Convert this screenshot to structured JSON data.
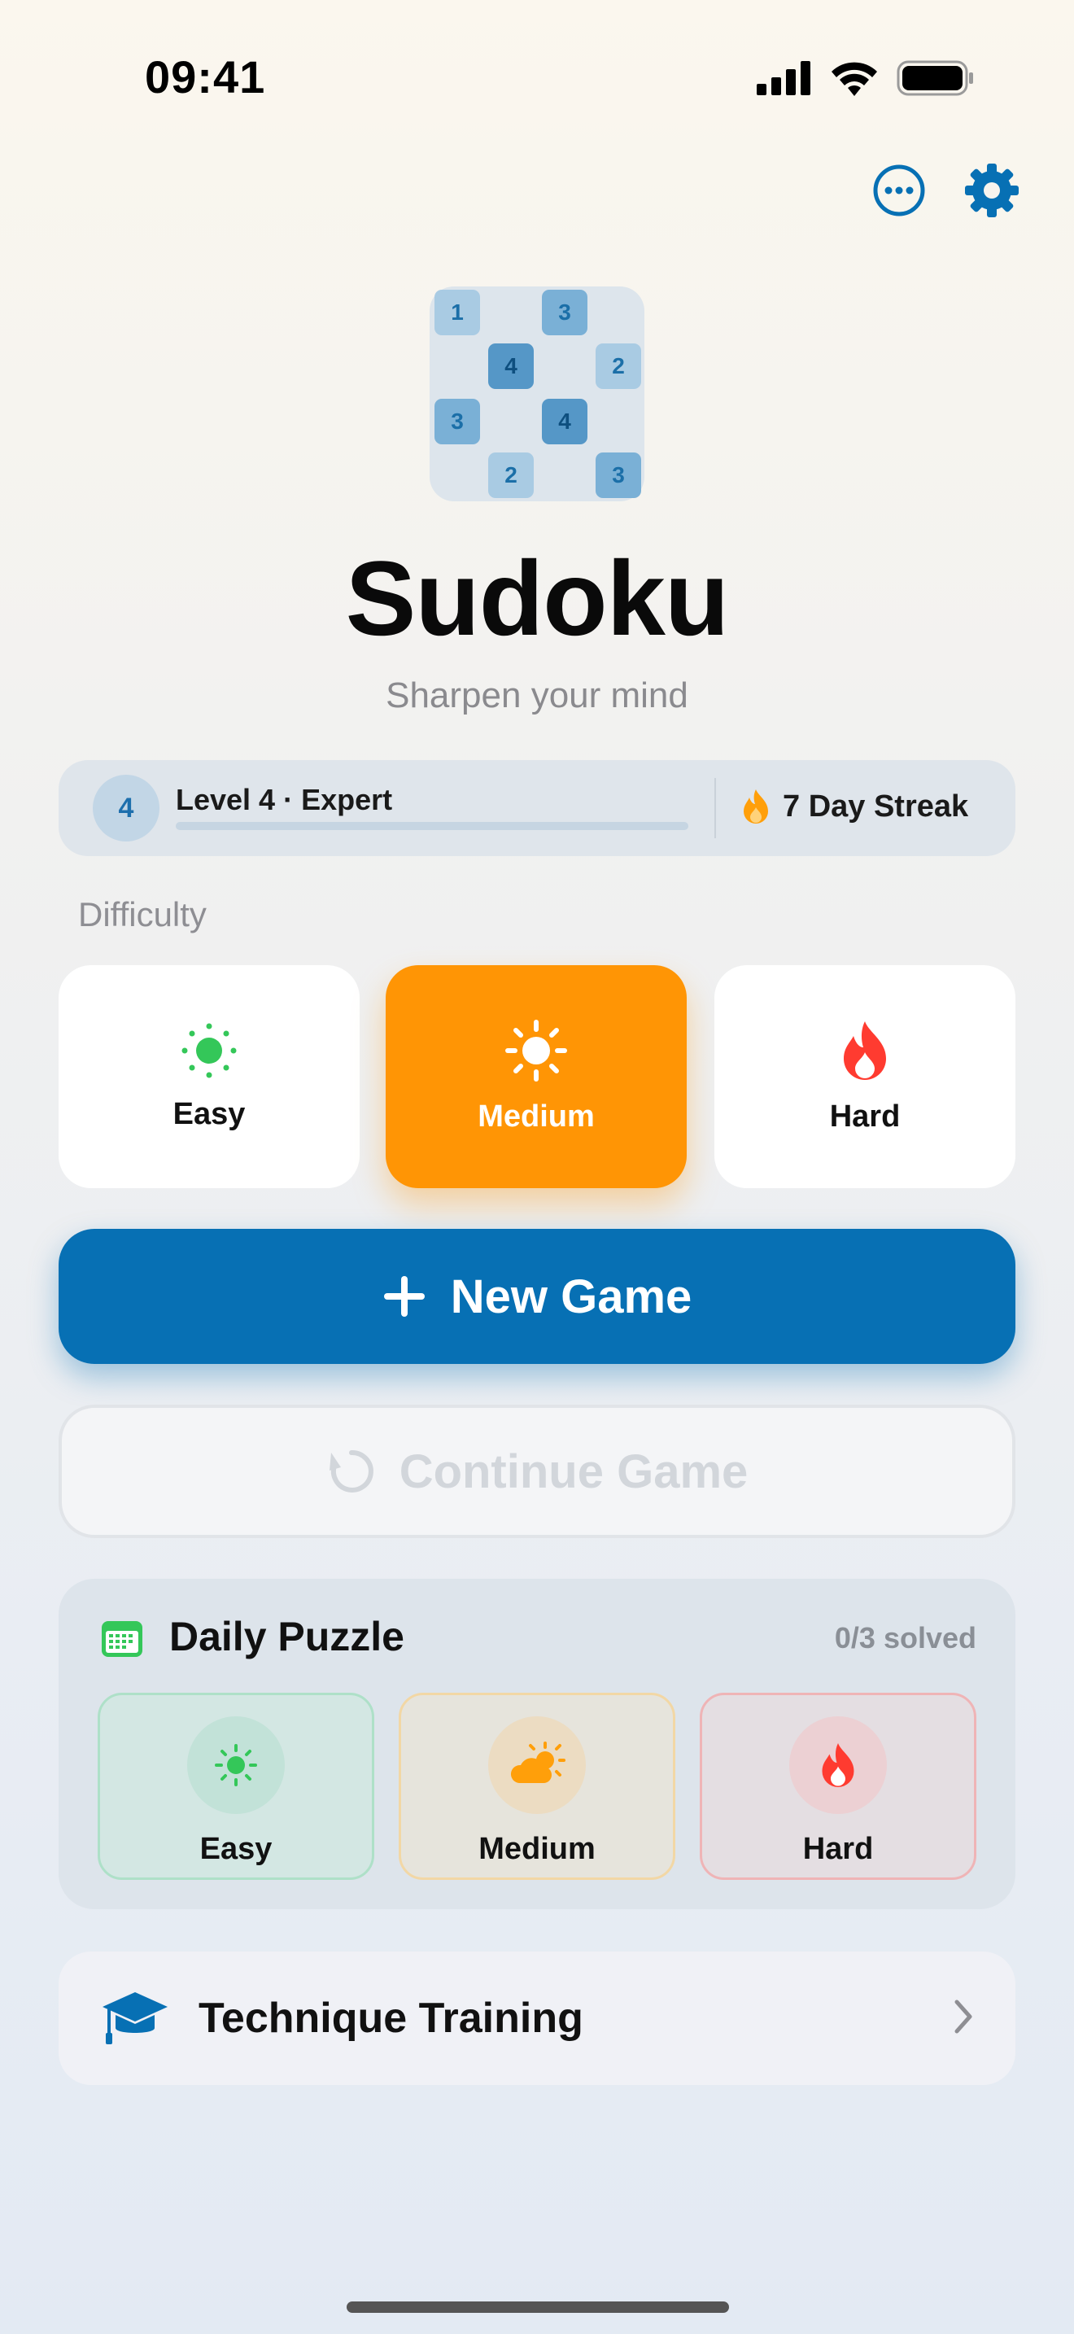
{
  "status_bar": {
    "time": "09:41"
  },
  "header": {
    "more_icon": "ellipsis-circle-icon",
    "settings_icon": "gear-icon"
  },
  "logo": {
    "cells": [
      {
        "value": "1"
      },
      {
        "value": "3"
      },
      {
        "value": "4"
      },
      {
        "value": "2"
      },
      {
        "value": "3"
      },
      {
        "value": "4"
      },
      {
        "value": "2"
      },
      {
        "value": "3"
      }
    ]
  },
  "app": {
    "title": "Sudoku",
    "subtitle": "Sharpen your mind"
  },
  "level": {
    "badge": "4",
    "label": "Level 4 · Expert",
    "progress": 0.0,
    "streak": "7 Day Streak"
  },
  "difficulty": {
    "label": "Difficulty",
    "options": [
      {
        "label": "Easy",
        "icon": "sun-small-icon",
        "selected": false
      },
      {
        "label": "Medium",
        "icon": "sun-icon",
        "selected": true
      },
      {
        "label": "Hard",
        "icon": "flame-icon",
        "selected": false
      }
    ]
  },
  "actions": {
    "new_game": "New Game",
    "continue_game": "Continue Game"
  },
  "daily": {
    "title": "Daily Puzzle",
    "solved": "0/3 solved",
    "options": [
      {
        "label": "Easy",
        "icon": "sun-small-icon"
      },
      {
        "label": "Medium",
        "icon": "cloud-sun-icon"
      },
      {
        "label": "Hard",
        "icon": "flame-icon"
      }
    ]
  },
  "technique": {
    "label": "Technique Training"
  },
  "colors": {
    "accent": "#0770B4",
    "medium": "#FF9505",
    "easy": "#34C759",
    "hard": "#FF3B30"
  }
}
